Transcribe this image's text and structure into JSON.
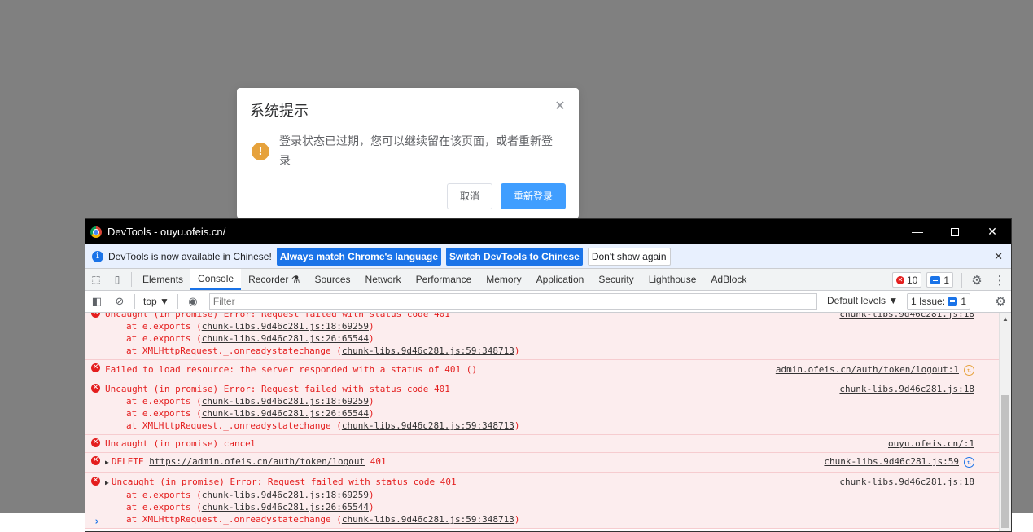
{
  "dialog": {
    "title": "系统提示",
    "message": "登录状态已过期，您可以继续留在该页面，或者重新登录",
    "cancel_label": "取消",
    "relogin_label": "重新登录",
    "warning_icon": "!"
  },
  "devtools": {
    "window_title": "DevTools - ouyu.ofeis.cn/",
    "infobar": {
      "text": "DevTools is now available in Chinese!",
      "match_label": "Always match Chrome's language",
      "switch_label": "Switch DevTools to Chinese",
      "dismiss_label": "Don't show again"
    },
    "tabs": [
      "Elements",
      "Console",
      "Recorder ⚗",
      "Sources",
      "Network",
      "Performance",
      "Memory",
      "Application",
      "Security",
      "Lighthouse",
      "AdBlock"
    ],
    "active_tab": "Console",
    "error_count": "10",
    "message_count": "1",
    "context": "top ▼",
    "filter_placeholder": "Filter",
    "levels": "Default levels ▼",
    "issues_label": "1 Issue:",
    "issues_count": "1",
    "entries": {
      "e0_text": "Uncaught (in promise) Error: Request failed with status code 401",
      "e0_src": "chunk-libs.9d46c281.js:18",
      "s1_fn": "at e.exports (",
      "s1_link": "chunk-libs.9d46c281.js:18:69259",
      "s2_fn": "at e.exports (",
      "s2_link": "chunk-libs.9d46c281.js:26:65544",
      "s3_fn": "at XMLHttpRequest._.onreadystatechange (",
      "s3_link": "chunk-libs.9d46c281.js:59:348713",
      "e1_text": "Failed to load resource: the server responded with a status of 401 ()",
      "e1_src": "admin.ofeis.cn/auth/token/logout:1",
      "e2_text": "Uncaught (in promise) Error: Request failed with status code 401",
      "e2_src": "chunk-libs.9d46c281.js:18",
      "e3_text": "Uncaught (in promise) cancel",
      "e3_src": "ouyu.ofeis.cn/:1",
      "e4_method": "DELETE",
      "e4_url": "https://admin.ofeis.cn/auth/token/logout",
      "e4_status": "401",
      "e4_src": "chunk-libs.9d46c281.js:59",
      "e5_text": "Uncaught (in promise) Error: Request failed with status code 401",
      "e5_src": "chunk-libs.9d46c281.js:18"
    }
  },
  "colors": {
    "error": "#e41e1e",
    "accent": "#1a73e8",
    "warning": "#e6a23c",
    "primary_button": "#409eff"
  }
}
